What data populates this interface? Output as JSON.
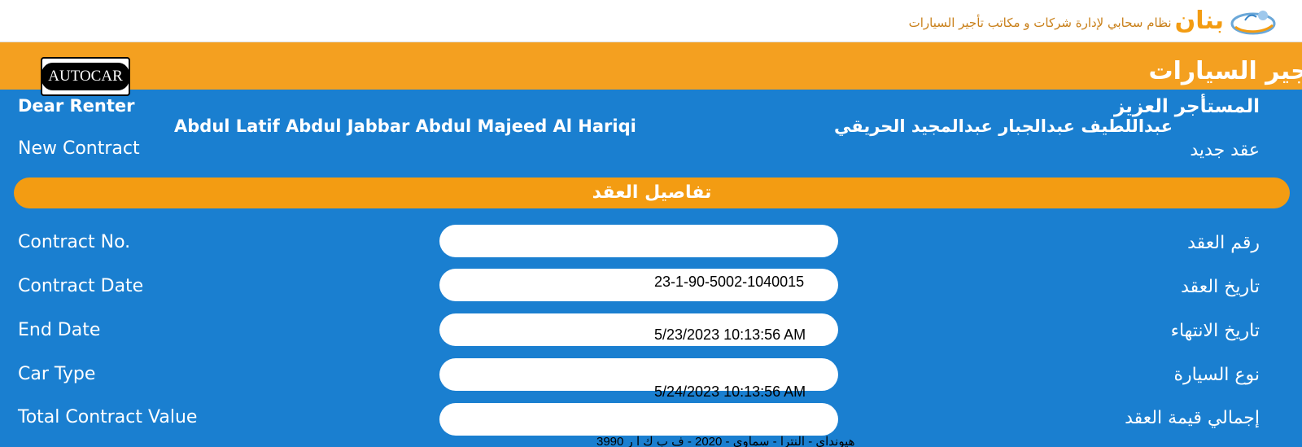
{
  "brand": {
    "name": "بنان",
    "tagline": "نظام سحابي لإدارة شركات و مكاتب تأجير السيارات",
    "logo_icon": "car-cloud-logo-icon"
  },
  "band_title": "أجير السيارات",
  "partner_logo": {
    "text": "AUTOCAR"
  },
  "renter": {
    "greeting_en": "Dear Renter",
    "greeting_ar": "المستأجر العزيز",
    "name_en": "Abdul Latif Abdul Jabbar Abdul Majeed Al Hariqi",
    "name_ar": "عبداللطيف عبدالجبار عبدالمجيد الحريقي",
    "status_en": "New Contract",
    "status_ar": "عقد جديد"
  },
  "section_title": "تفاصيل العقد",
  "fields": [
    {
      "label_en": "Contract No.",
      "label_ar": "رقم العقد",
      "value": ""
    },
    {
      "label_en": "Contract Date",
      "label_ar": "تاريخ العقد",
      "value": ""
    },
    {
      "label_en": "End Date",
      "label_ar": "تاريخ الانتهاء",
      "value": ""
    },
    {
      "label_en": "Car Type",
      "label_ar": "نوع السيارة",
      "value": ""
    },
    {
      "label_en": "Total Contract Value",
      "label_ar": "إجمالي قيمة العقد",
      "value": ""
    }
  ],
  "overlays": {
    "contract_number": "23-1-90-5002-1040015",
    "contract_date": "5/23/2023 10:13:56 AM",
    "end_date": "5/24/2023 10:13:56 AM",
    "car_type": "هيونداي - النترا - سماوي - 2020 - ف ب ك ا ر 3990"
  },
  "colors": {
    "background_blue": "#1a7fd0",
    "accent_orange": "#f39c12",
    "white": "#ffffff"
  }
}
